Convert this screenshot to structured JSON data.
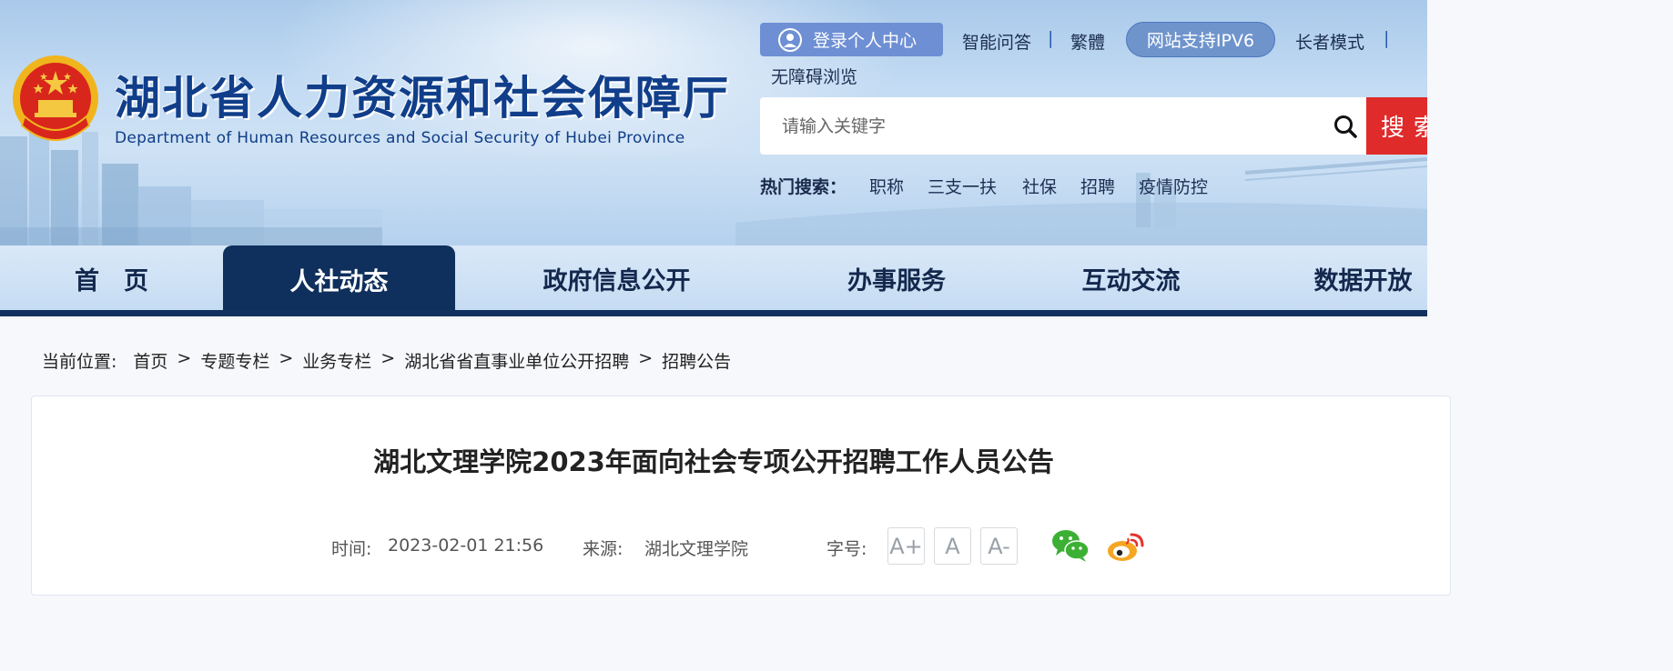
{
  "header": {
    "site_title": "湖北省人力资源和社会保障厅",
    "site_subtitle": "Department of Human Resources and Social Security of Hubei Province",
    "login_label": "登录个人中心",
    "links": {
      "qa": "智能问答",
      "traditional": "繁體",
      "ipv6": "网站支持IPV6",
      "elder_mode": "长者模式",
      "accessible": "无障碍浏览",
      "separator": "|"
    },
    "search": {
      "placeholder": "请输入关键字",
      "button_label": "搜索"
    },
    "hot_search": {
      "label": "热门搜索：",
      "items": [
        "职称",
        "三支一扶",
        "社保",
        "招聘",
        "疫情防控"
      ]
    }
  },
  "nav": {
    "items": [
      "首　页",
      "人社动态",
      "政府信息公开",
      "办事服务",
      "互动交流",
      "数据开放"
    ],
    "active_index": 1
  },
  "breadcrumb": {
    "label": "当前位置:",
    "items": [
      "首页",
      "专题专栏",
      "业务专栏",
      "湖北省省直事业单位公开招聘",
      "招聘公告"
    ],
    "separator": ">"
  },
  "article": {
    "title": "湖北文理学院2023年面向社会专项公开招聘工作人员公告",
    "time_label": "时间:",
    "time": "2023-02-01 21:56",
    "source_label": "来源:",
    "source": "湖北文理学院",
    "font_size_label": "字号:",
    "font_buttons": [
      "A+",
      "A",
      "A-"
    ]
  },
  "colors": {
    "brand_blue": "#103e8a",
    "nav_dark": "#0f2f5c",
    "search_red": "#e02b2b",
    "wechat_green": "#3cb034",
    "weibo_orange": "#f5a623"
  }
}
